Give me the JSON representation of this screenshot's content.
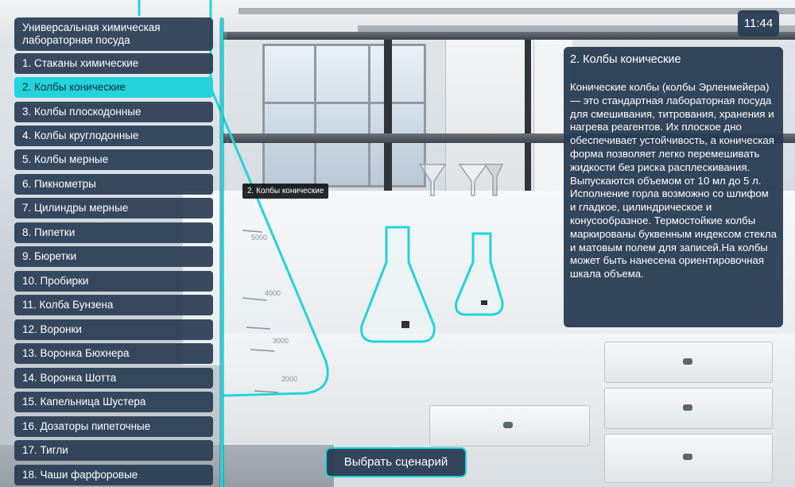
{
  "menu": {
    "title": "Универсальная химическая лабораторная посуда",
    "items": [
      {
        "label": "1.  Стаканы химические"
      },
      {
        "label": "2.  Колбы конические"
      },
      {
        "label": "3.  Колбы плоскодонные"
      },
      {
        "label": "4.  Колбы круглодонные"
      },
      {
        "label": "5.  Колбы мерные"
      },
      {
        "label": "6.  Пикнометры"
      },
      {
        "label": "7.  Цилиндры мерные"
      },
      {
        "label": "8.  Пипетки"
      },
      {
        "label": "9.  Бюретки"
      },
      {
        "label": "10.  Пробирки"
      },
      {
        "label": "11.  Колба Бунзена"
      },
      {
        "label": "12.  Воронки"
      },
      {
        "label": "13.  Воронка Бюхнера"
      },
      {
        "label": "14.  Воронка Шотта"
      },
      {
        "label": "15.  Капельница Шустера"
      },
      {
        "label": "16.  Дозаторы пипеточные"
      },
      {
        "label": "17.  Тигли"
      },
      {
        "label": "18.  Чаши фарфоровые"
      }
    ],
    "active_index": 1
  },
  "clock": "11:44",
  "info": {
    "title": "2.  Колбы конические",
    "body": "Конические колбы (колбы Эрленмейера) — это стандартная лабораторная посуда для смешивания, титрования, хранения и нагрева реагентов. Их плоское дно обеспечивает устойчивость, а коническая форма позволяет легко перемешивать жидкости без риска расплескивания. Выпускаются объемом от 10 мл до 5 л. Исполнение горла возможно со шлифом и гладкое, цилиндрическое и конусообразное. Термостойкие колбы маркированы буквенным индексом стекла и матовым полем для записей.На колбы может быть нанесена ориентировочная шкала объема."
  },
  "tooltip": "2. Колбы конические",
  "scenario_button": "Выбрать сценарий",
  "beaker_marks": [
    "5000",
    "4000",
    "3000",
    "2000"
  ],
  "colors": {
    "accent": "#22d3db",
    "panel": "#293c52"
  }
}
